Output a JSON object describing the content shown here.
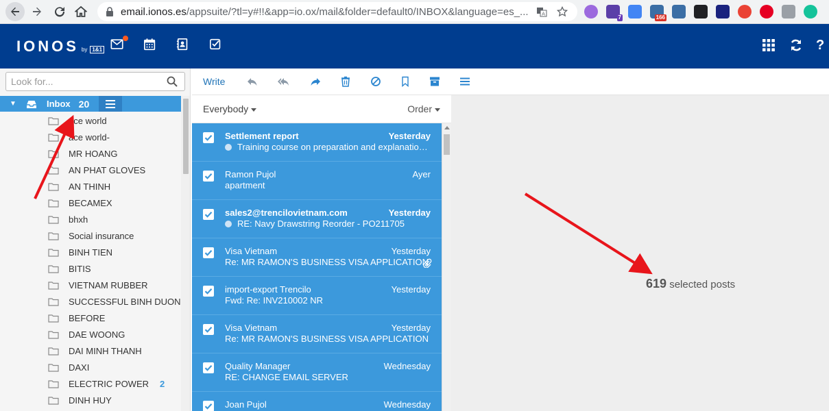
{
  "browser": {
    "url_host": "email.ionos.es",
    "url_rest": "/appsuite/?tl=y#!!&app=io.ox/mail&folder=default0/INBOX&language=es_...",
    "extensions": [
      {
        "name": "ext-purple-circle",
        "color": "#9c6ade"
      },
      {
        "name": "ext-graduation",
        "color": "#5b3fa8",
        "badge": "7"
      },
      {
        "name": "ext-translate",
        "color": "#4285f4"
      },
      {
        "name": "ext-mail-counter",
        "color": "#3b6ea5",
        "badge": "166"
      },
      {
        "name": "ext-puzzle",
        "color": "#3b6ea5"
      },
      {
        "name": "ext-sync",
        "color": "#202124"
      },
      {
        "name": "ext-ip",
        "color": "#1a237e"
      },
      {
        "name": "ext-colorwheel",
        "color": "#ea4335"
      },
      {
        "name": "ext-pinterest",
        "color": "#e60023"
      },
      {
        "name": "ext-bolt",
        "color": "#9aa0a6"
      },
      {
        "name": "ext-grammarly",
        "color": "#15c39a"
      }
    ]
  },
  "header": {
    "logo": "IONOS",
    "logo_by": "by",
    "logo_brand": "1&1",
    "apps": [
      "mail-icon",
      "calendar-icon",
      "contacts-icon",
      "tasks-icon"
    ],
    "right_icons": [
      "apps-grid-icon",
      "refresh-icon",
      "help-icon"
    ],
    "help_label": "?"
  },
  "search": {
    "placeholder": "Look for..."
  },
  "inbox": {
    "label": "Inbox",
    "count": "20"
  },
  "folders": [
    {
      "name": "ace world"
    },
    {
      "name": "ace world-"
    },
    {
      "name": "MR HOANG"
    },
    {
      "name": "AN PHAT GLOVES"
    },
    {
      "name": "AN THINH"
    },
    {
      "name": "BECAMEX"
    },
    {
      "name": "bhxh"
    },
    {
      "name": "Social insurance"
    },
    {
      "name": "BINH TIEN"
    },
    {
      "name": "BITIS"
    },
    {
      "name": "VIETNAM RUBBER"
    },
    {
      "name": "SUCCESSFUL BINH DUON"
    },
    {
      "name": "BEFORE"
    },
    {
      "name": "DAE WOONG"
    },
    {
      "name": "DAI MINH THANH"
    },
    {
      "name": "DAXI"
    },
    {
      "name": "ELECTRIC POWER",
      "count": "2"
    },
    {
      "name": "DINH HUY"
    }
  ],
  "toolbar": {
    "write": "Write",
    "icons": [
      "reply-icon",
      "reply-all-icon",
      "forward-icon",
      "delete-icon",
      "spam-icon",
      "flag-icon",
      "archive-icon",
      "more-menu-icon"
    ]
  },
  "list": {
    "filter": "Everybody",
    "sort": "Order",
    "mails": [
      {
        "from": "Settlement report",
        "date": "Yesterday",
        "subject": "Training course on preparation and explanation of",
        "unread": true
      },
      {
        "from": "Ramon Pujol",
        "date": "Ayer",
        "subject": "apartment",
        "unread": false
      },
      {
        "from": "sales2@trencilovietnam.com",
        "date": "Yesterday",
        "subject": "RE: Navy Drawstring Reorder - PO211705",
        "unread": true
      },
      {
        "from": "Visa Vietnam",
        "date": "Yesterday",
        "subject": "Re: MR RAMON'S BUSINESS VISA APPLICATION",
        "unread": false,
        "attachment": true
      },
      {
        "from": "import-export Trencilo",
        "date": "Yesterday",
        "subject": "Fwd: Re: INV210002 NR",
        "unread": false
      },
      {
        "from": "Visa Vietnam",
        "date": "Yesterday",
        "subject": "Re: MR RAMON'S BUSINESS VISA APPLICATION",
        "unread": false
      },
      {
        "from": "Quality Manager",
        "date": "Wednesday",
        "subject": "RE: CHANGE EMAIL SERVER",
        "unread": false
      },
      {
        "from": "Joan Pujol",
        "date": "Wednesday",
        "subject": "",
        "unread": false
      }
    ]
  },
  "detail": {
    "selected_count": "619",
    "selected_label": "selected posts"
  },
  "colors": {
    "header": "#003d8f",
    "selection": "#3c99dc",
    "accent": "#2b85cf",
    "arrow": "#e8151b"
  }
}
